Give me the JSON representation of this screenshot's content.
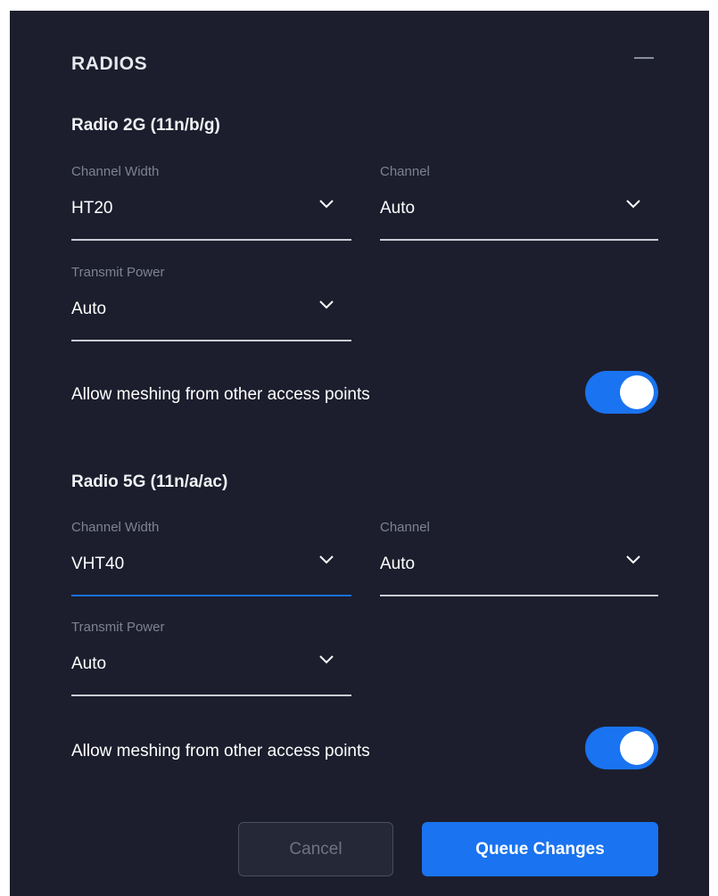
{
  "section": {
    "title": "RADIOS"
  },
  "radio_2g": {
    "title": "Radio 2G (11n/b/g)",
    "channel_width": {
      "label": "Channel Width",
      "value": "HT20"
    },
    "channel": {
      "label": "Channel",
      "value": "Auto"
    },
    "transmit_power": {
      "label": "Transmit Power",
      "value": "Auto"
    },
    "mesh": {
      "label": "Allow meshing from other access points",
      "enabled": true
    }
  },
  "radio_5g": {
    "title": "Radio 5G (11n/a/ac)",
    "channel_width": {
      "label": "Channel Width",
      "value": "VHT40"
    },
    "channel": {
      "label": "Channel",
      "value": "Auto"
    },
    "transmit_power": {
      "label": "Transmit Power",
      "value": "Auto"
    },
    "mesh": {
      "label": "Allow meshing from other access points",
      "enabled": true
    }
  },
  "actions": {
    "cancel_label": "Cancel",
    "queue_label": "Queue Changes"
  },
  "colors": {
    "panel_bg": "#1c1e2d",
    "accent": "#1a73f0",
    "label_muted": "#7e8291"
  }
}
